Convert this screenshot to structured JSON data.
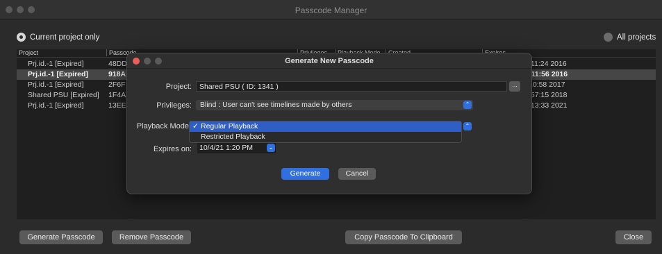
{
  "window": {
    "title": "Passcode Manager"
  },
  "scope": {
    "current_label": "Current project only",
    "all_label": "All projects"
  },
  "table": {
    "headers": [
      "Project",
      "Passcode",
      "Privileges",
      "Playback Mode",
      "Created",
      "Expires"
    ],
    "rows": [
      {
        "project": "Prj.id.-1 [Expired]",
        "passcode": "48DD",
        "expires": ":11:24 2016",
        "selected": false
      },
      {
        "project": "Prj.id.-1 [Expired]",
        "passcode": "918A",
        "expires": ":11:56 2016",
        "selected": true
      },
      {
        "project": "Prj.id.-1 [Expired]",
        "passcode": "2F6F",
        "expires": "10:58 2017",
        "selected": false
      },
      {
        "project": "Shared PSU [Expired]",
        "passcode": "1F4A",
        "expires": ":57:15 2018",
        "selected": false
      },
      {
        "project": "Prj.id.-1 [Expired]",
        "passcode": "13EE",
        "expires": ":13:33 2021",
        "selected": false
      }
    ]
  },
  "buttons": {
    "generate": "Generate Passcode",
    "remove": "Remove Passcode",
    "copy": "Copy Passcode To Clipboard",
    "close": "Close"
  },
  "dialog": {
    "title": "Generate New Passcode",
    "project_label": "Project:",
    "project_value": "Shared PSU ( ID: 1341 )",
    "browse_label": "...",
    "privileges_label": "Privileges:",
    "privileges_value": "Blind : User can't see timelines made by others",
    "playback_label": "Playback Mode",
    "playback_options": [
      "Regular Playback",
      "Restricted Playback"
    ],
    "playback_selected": "Regular Playback",
    "check_mark": "✓",
    "expires_label": "Expires on:",
    "expires_value": "10/4/21 1:20 PM",
    "generate_button": "Generate",
    "cancel_button": "Cancel"
  },
  "colors": {
    "accent": "#2f6fe0",
    "menu_highlight": "#2f5fc4",
    "close_red": "#ec5e57"
  }
}
